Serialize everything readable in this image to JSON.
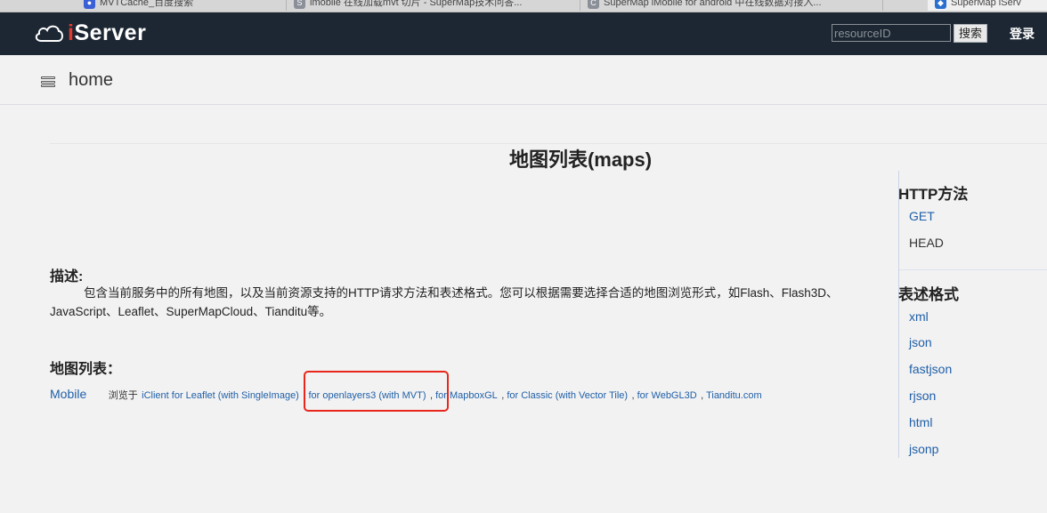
{
  "browser_tabs": [
    {
      "label": "MVTCache_百度搜索",
      "icon": "baidu-favicon"
    },
    {
      "label": "imobile 在线加载mvt 切片 - SuperMap技术问答...",
      "icon": "s-favicon"
    },
    {
      "label": "SuperMap iMobile for android 中在线数据对接入...",
      "icon": "c-favicon"
    },
    {
      "label": "SuperMap iServ",
      "icon": "supermap-favicon"
    }
  ],
  "header": {
    "logo_i": "i",
    "logo_rest": "Server",
    "search_placeholder": "resourceID",
    "search_button": "搜索",
    "login": "登录"
  },
  "breadcrumb": {
    "home": "home"
  },
  "page_title": "地图列表(maps)",
  "description": {
    "heading": "描述:",
    "text": "包含当前服务中的所有地图，以及当前资源支持的HTTP请求方法和表述格式。您可以根据需要选择合适的地图浏览形式，如Flash、Flash3D、JavaScript、Leaflet、SuperMapCloud、Tianditu等。"
  },
  "map_list": {
    "heading": "地图列表：",
    "items": [
      {
        "name": "Mobile",
        "browse_label": "浏览于",
        "links": [
          "iClient for Leaflet (with SingleImage)",
          "for openlayers3 (with MVT)",
          "for MapboxGL",
          "for Classic (with Vector Tile)",
          "for WebGL3D",
          "Tianditu.com"
        ],
        "separator": ","
      }
    ]
  },
  "side_panel": {
    "http_heading": "HTTP方法",
    "http_methods": [
      {
        "label": "GET",
        "link": true
      },
      {
        "label": "HEAD",
        "link": false
      }
    ],
    "format_heading": "表述格式",
    "formats": [
      "xml",
      "json",
      "fastjson",
      "rjson",
      "html",
      "jsonp"
    ]
  },
  "colors": {
    "header_bg": "#1c2733",
    "link": "#1f5fa8",
    "highlight": "#e8261c",
    "logo_accent": "#e03a2f"
  }
}
